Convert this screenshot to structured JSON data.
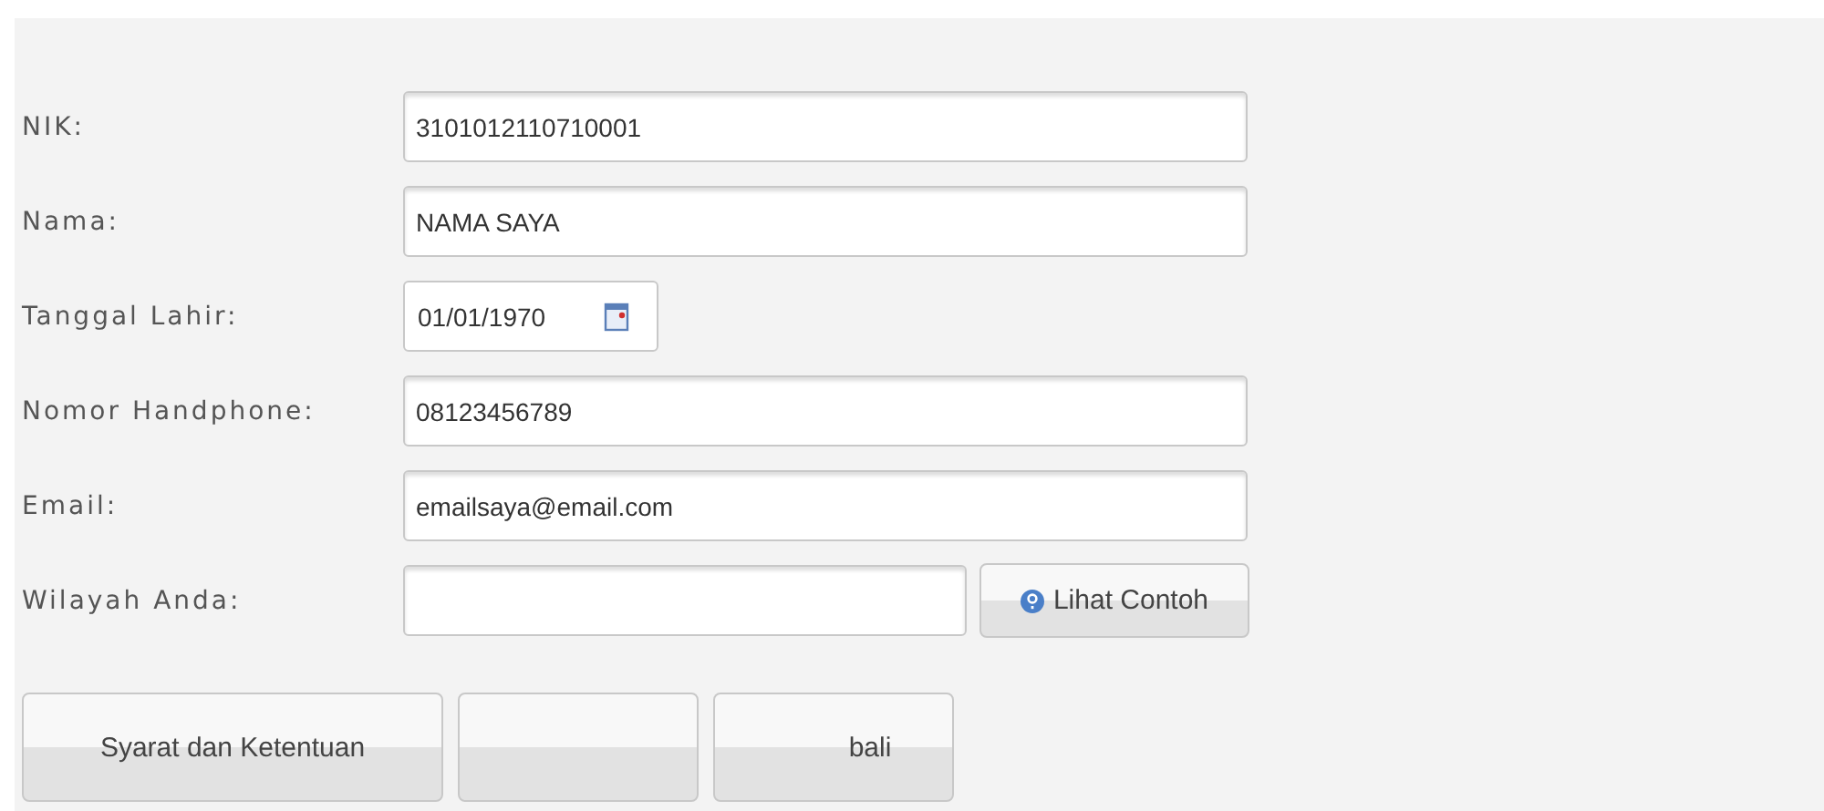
{
  "form": {
    "fields": [
      {
        "label": "NIK:",
        "kind": "text",
        "value": "3101012110710001"
      },
      {
        "label": "Nama:",
        "kind": "text",
        "value": "NAMA SAYA"
      },
      {
        "label": "Tanggal Lahir:",
        "kind": "date",
        "value": "01/01/1970"
      },
      {
        "label": "Nomor Handphone:",
        "kind": "text",
        "value": "08123456789"
      },
      {
        "label": "Email:",
        "kind": "text",
        "value": "emailsaya@email.com"
      },
      {
        "label": "Wilayah Anda:",
        "kind": "lookup",
        "button": "Lihat Contoh"
      }
    ]
  },
  "buttons": [
    {
      "kind": "text",
      "label": "Syarat dan Ketentuan"
    },
    {
      "kind": "blank"
    },
    {
      "kind": "text",
      "label": "bali"
    }
  ]
}
